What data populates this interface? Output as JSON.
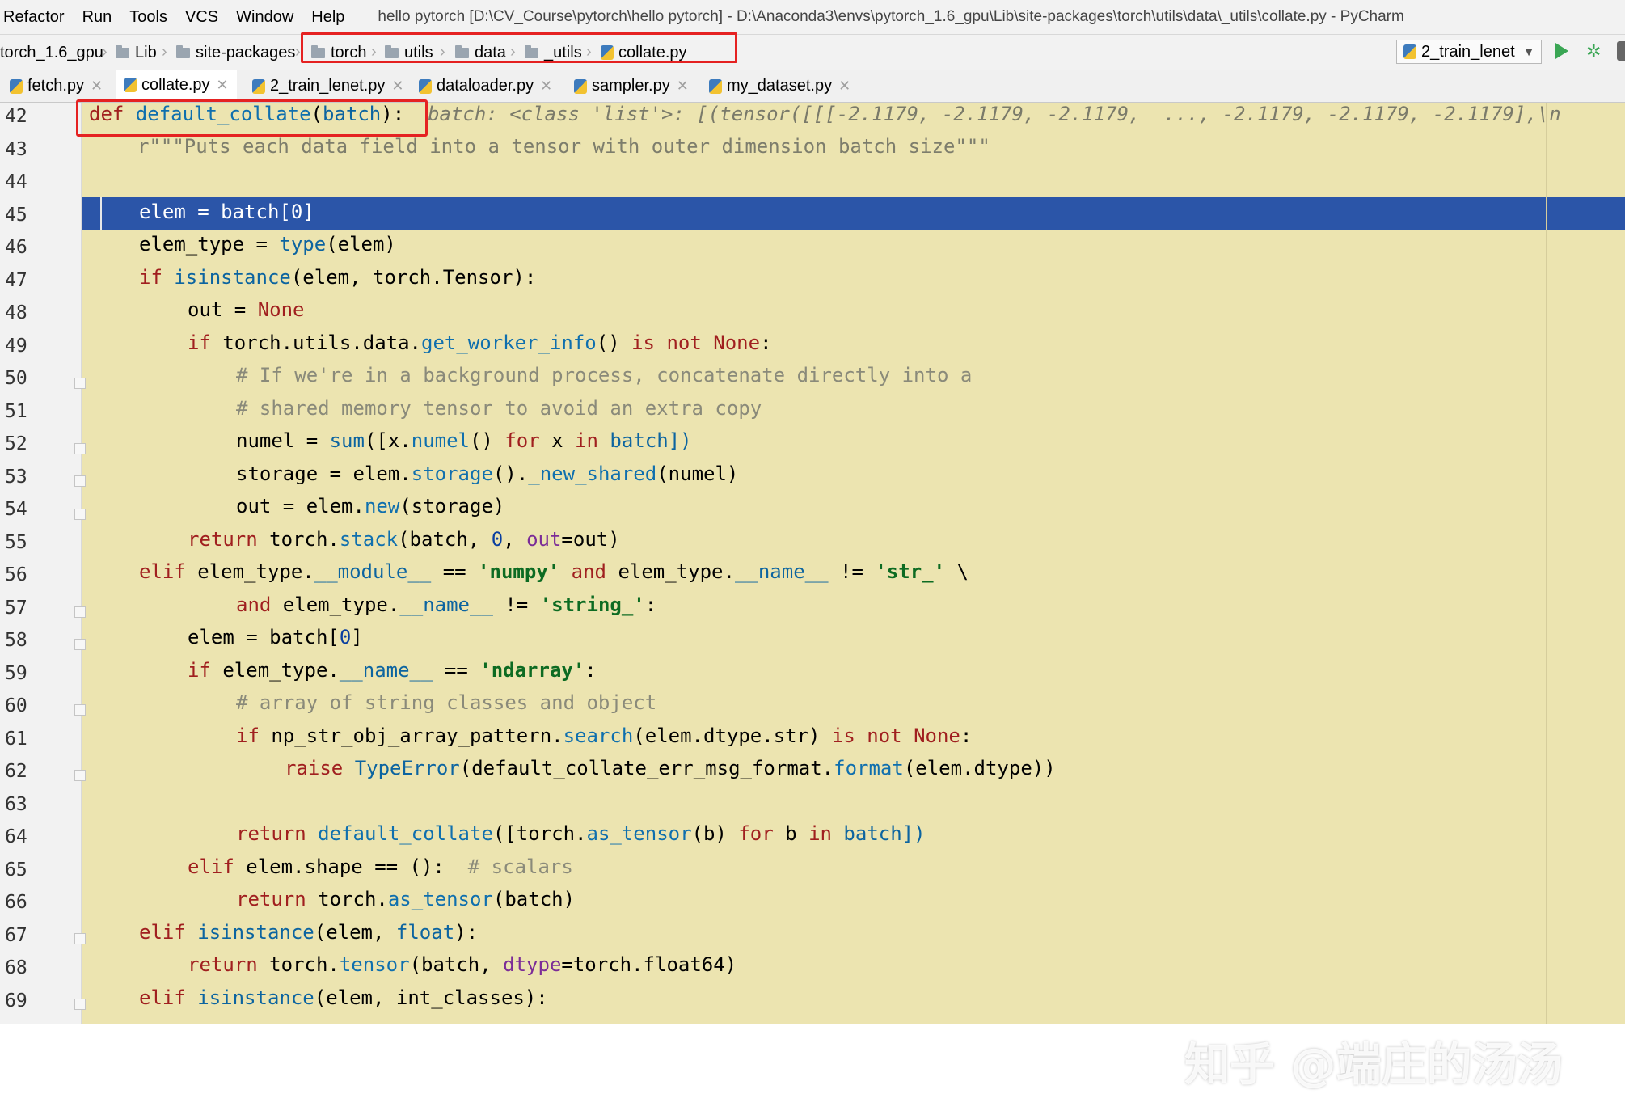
{
  "menu": {
    "items": [
      "Refactor",
      "Run",
      "Tools",
      "VCS",
      "Window",
      "Help"
    ],
    "title": "hello pytorch [D:\\CV_Course\\pytorch\\hello pytorch] - D:\\Anaconda3\\envs\\pytorch_1.6_gpu\\Lib\\site-packages\\torch\\utils\\data\\_utils\\collate.py - PyCharm"
  },
  "breadcrumb": {
    "items": [
      "torch_1.6_gpu",
      "Lib",
      "site-packages",
      "torch",
      "utils",
      "data",
      "_utils",
      "collate.py"
    ]
  },
  "run_config": {
    "label": "2_train_lenet"
  },
  "tabs": [
    {
      "label": "fetch.py"
    },
    {
      "label": "collate.py"
    },
    {
      "label": "2_train_lenet.py"
    },
    {
      "label": "dataloader.py"
    },
    {
      "label": "sampler.py"
    },
    {
      "label": "my_dataset.py"
    }
  ],
  "editor": {
    "line_numbers": [
      "42",
      "43",
      "44",
      "45",
      "46",
      "47",
      "48",
      "49",
      "50",
      "51",
      "52",
      "53",
      "54",
      "55",
      "56",
      "57",
      "58",
      "59",
      "60",
      "61",
      "62",
      "63",
      "64",
      "65",
      "66",
      "67",
      "68",
      "69"
    ],
    "current_line": "45",
    "lines": {
      "l42": {
        "def": "def ",
        "name": "default_collate",
        "p1": "(",
        "arg": "batch",
        "p2": "):",
        "hint": "batch: <class 'list'>: [(tensor([[[-2.1179, -2.1179, -2.1179,  ..., -2.1179, -2.1179, -2.1179],\\n"
      },
      "l43": "r\"\"\"Puts each data field into a tensor with outer dimension batch size\"\"\"",
      "l45": "elem = batch[0]",
      "l46": {
        "a": "elem_type = ",
        "b": "type",
        "c": "(elem)"
      },
      "l47": {
        "a": "if ",
        "b": "isinstance",
        "c": "(elem, torch",
        "d": ".",
        "e": "Tensor):"
      },
      "l48": {
        "a": "out = ",
        "b": "None"
      },
      "l49": {
        "a": "if ",
        "b": "torch.utils.data.",
        "c": "get_worker_info",
        "d": "() ",
        "e": "is not None",
        "f": ":"
      },
      "l50": "# If we're in a background process, concatenate directly into a",
      "l51": "# shared memory tensor to avoid an extra copy",
      "l52": {
        "a": "numel = ",
        "b": "sum",
        "c": "([x.",
        "d": "numel",
        "e": "() ",
        "f": "for",
        "g": " x ",
        "h": "in",
        "i": " batch])"
      },
      "l53": {
        "a": "storage = elem.",
        "b": "storage",
        "c": "().",
        "d": "_new_shared",
        "e": "(numel)"
      },
      "l54": {
        "a": "out = elem.",
        "b": "new",
        "c": "(storage)"
      },
      "l55": {
        "a": "return",
        "b": " torch.",
        "c": "stack",
        "d": "(batch, ",
        "e": "0",
        "f": ", ",
        "g": "out",
        "h": "=out)"
      },
      "l56": {
        "a": "elif",
        "b": " elem_type.",
        "c": "__module__",
        "d": " == ",
        "e": "'numpy'",
        "f": " and",
        "g": " elem_type.",
        "h": "__name__",
        "i": " != ",
        "j": "'str_'",
        "k": " \\"
      },
      "l57": {
        "a": "and",
        "b": " elem_type.",
        "c": "__name__",
        "d": " != ",
        "e": "'string_'",
        "f": ":"
      },
      "l58": {
        "a": "elem = batch[",
        "b": "0",
        "c": "]"
      },
      "l59": {
        "a": "if",
        "b": " elem_type.",
        "c": "__name__",
        "d": " == ",
        "e": "'ndarray'",
        "f": ":"
      },
      "l60": "# array of string classes and object",
      "l61": {
        "a": "if",
        "b": " np_str_obj_array_pattern.",
        "c": "search",
        "d": "(elem.dtype.str) ",
        "e": "is not None",
        "f": ":"
      },
      "l62": {
        "a": "raise ",
        "b": "TypeError",
        "c": "(default_collate_err_msg_format.",
        "d": "format",
        "e": "(elem.dtype))"
      },
      "l64": {
        "a": "return ",
        "b": "default_collate",
        "c": "([torch.",
        "d": "as_tensor",
        "e": "(b) ",
        "f": "for",
        "g": " b ",
        "h": "in",
        "i": " batch])"
      },
      "l65": {
        "a": "elif",
        "b": " elem.shape == ():  ",
        "c": "# scalars"
      },
      "l66": {
        "a": "return",
        "b": " torch.",
        "c": "as_tensor",
        "d": "(batch)"
      },
      "l67": {
        "a": "elif ",
        "b": "isinstance",
        "c": "(elem, ",
        "d": "float",
        "e": "):"
      },
      "l68": {
        "a": "return",
        "b": " torch.",
        "c": "tensor",
        "d": "(batch, ",
        "e": "dtype",
        "f": "=torch.float64)"
      },
      "l69": {
        "a": "elif ",
        "b": "isinstance",
        "c": "(elem, int_classes):"
      }
    }
  },
  "watermark": "知乎 @端庄的汤汤",
  "colors": {
    "editor_bg": "#ece4b0",
    "current_line": "#2b55a8",
    "highlight_box": "#e52222",
    "run_green": "#3aa654"
  }
}
